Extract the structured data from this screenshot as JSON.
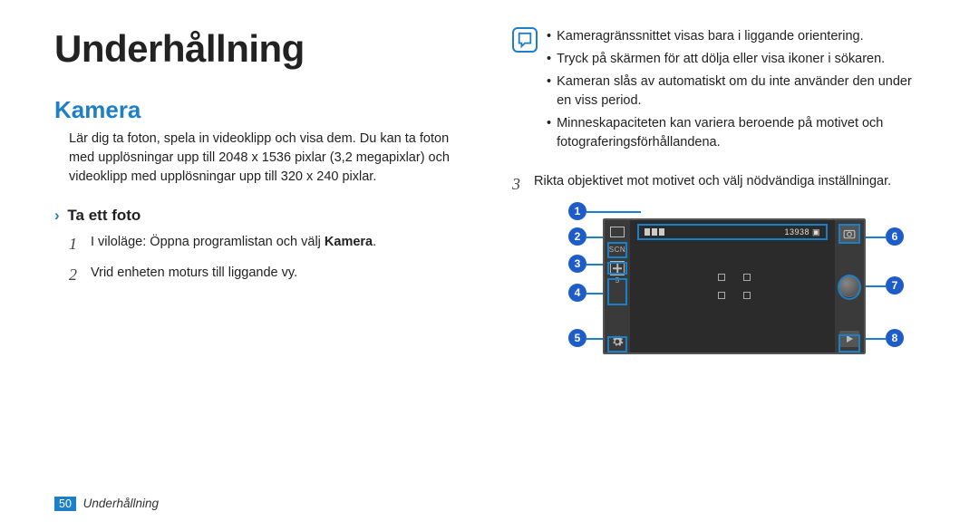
{
  "title": "Underhållning",
  "section": "Kamera",
  "intro": "Lär dig ta foton, spela in videoklipp och visa dem. Du kan ta foton med upplösningar upp till 2048 x 1536 pixlar (3,2 megapixlar) och videoklipp med upplösningar upp till 320 x 240 pixlar.",
  "subsection": "Ta ett foto",
  "chevron": "›",
  "steps": {
    "n1": "1",
    "s1a": "I viloläge: Öppna programlistan och välj ",
    "s1b": "Kamera",
    "s1c": ".",
    "n2": "2",
    "s2": "Vrid enheten moturs till liggande vy.",
    "n3": "3",
    "s3": "Rikta objektivet mot motivet och välj nödvändiga inställningar."
  },
  "notes": {
    "a": "Kameragränssnittet visas bara i liggande orientering.",
    "b": "Tryck på skärmen för att dölja eller visa ikoner i sökaren.",
    "c": "Kameran slås av automatiskt om du inte använder den under en viss period.",
    "d": "Minneskapaciteten kan variera beroende på motivet och fotograferingsförhållandena."
  },
  "camera": {
    "counter": "13938",
    "scn": "SCN",
    "ev": "5"
  },
  "callouts": {
    "c1": "1",
    "c2": "2",
    "c3": "3",
    "c4": "4",
    "c5": "5",
    "c6": "6",
    "c7": "7",
    "c8": "8"
  },
  "footer": {
    "page": "50",
    "label": "Underhållning"
  }
}
